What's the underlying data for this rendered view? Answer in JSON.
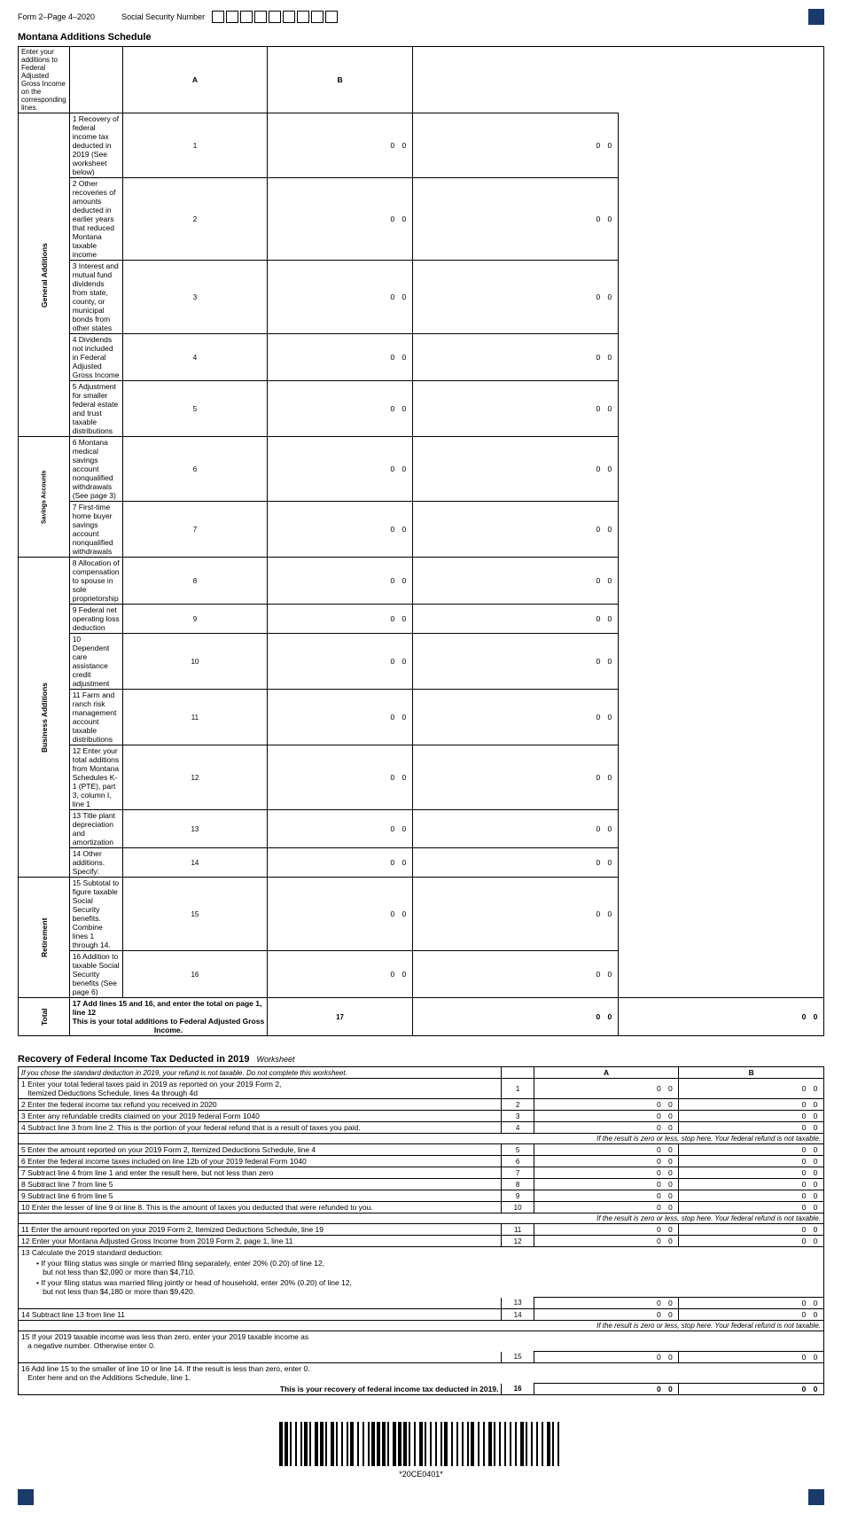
{
  "header": {
    "form_label": "Form 2–Page 4–2020",
    "ssn_label": "Social Security Number",
    "ssn_boxes": 9
  },
  "additions": {
    "title": "Montana Additions Schedule",
    "instruction": "Enter your additions to Federal Adjusted Gross Income on the corresponding lines.",
    "col_a": "A",
    "col_b": "B",
    "categories": {
      "general": "General Additions",
      "savings": "Savings Accounts",
      "business": "Business Additions",
      "retirement": "Retirement",
      "total": "Total"
    },
    "lines": [
      {
        "num": 1,
        "text": "1 Recovery of federal income tax deducted in 2019 (See worksheet below)",
        "cat": "general"
      },
      {
        "num": 2,
        "text": "2 Other recoveries of amounts deducted in earlier years that reduced Montana taxable income",
        "cat": "general"
      },
      {
        "num": 3,
        "text": "3 Interest and mutual fund dividends from state, county, or municipal bonds from other states",
        "cat": "general"
      },
      {
        "num": 4,
        "text": "4 Dividends not included in Federal Adjusted Gross Income",
        "cat": "general"
      },
      {
        "num": 5,
        "text": "5 Adjustment for smaller federal estate and trust taxable distributions",
        "cat": "general"
      },
      {
        "num": 6,
        "text": "6 Montana medical savings account nonqualified withdrawals (See page 3)",
        "cat": "savings"
      },
      {
        "num": 7,
        "text": "7 First-time home buyer savings account nonqualified withdrawals",
        "cat": "savings"
      },
      {
        "num": 8,
        "text": "8 Allocation of compensation to spouse in sole proprietorship",
        "cat": "business"
      },
      {
        "num": 9,
        "text": "9 Federal net operating loss deduction",
        "cat": "business"
      },
      {
        "num": 10,
        "text": "10 Dependent care assistance credit adjustment",
        "cat": "business"
      },
      {
        "num": 11,
        "text": "11 Farm and ranch risk management account taxable distributions",
        "cat": "business"
      },
      {
        "num": 12,
        "text": "12 Enter your total additions from Montana Schedules K-1 (PTE), part 3, column I, line 1",
        "cat": "business"
      },
      {
        "num": 13,
        "text": "13 Title plant depreciation and amortization",
        "cat": "business"
      },
      {
        "num": 14,
        "text": "14 Other additions. Specify:",
        "cat": "business"
      },
      {
        "num": 15,
        "text": "15 Subtotal to figure taxable Social Security benefits. Combine lines 1 through 14.",
        "cat": "retirement"
      },
      {
        "num": 16,
        "text": "16 Addition to taxable Social Security benefits (See page 6)",
        "cat": "retirement"
      },
      {
        "num": 17,
        "text": "17 Add lines 15 and 16, and enter the total on page 1, line 12",
        "cat": "total"
      }
    ],
    "total_label": "This is your total additions to Federal Adjusted Gross Income.",
    "total_line": "17"
  },
  "worksheet": {
    "title": "Recovery of Federal Income Tax Deducted in 2019",
    "label": "Worksheet",
    "col_a": "A",
    "col_b": "B",
    "instruction": "If you chose the standard deduction in 2019, your refund is not taxable. Do not complete this worksheet.",
    "lines": [
      {
        "num": 1,
        "text": "1 Enter your total federal taxes paid in 2019 as reported on your 2019 Form 2, Itemized Deductions Schedule, lines 4a through 4d"
      },
      {
        "num": 2,
        "text": "2 Enter the federal income tax refund you received in 2020"
      },
      {
        "num": 3,
        "text": "3 Enter any refundable credits claimed on your 2019 federal Form 1040"
      },
      {
        "num": 4,
        "text": "4 Subtract line 3 from line 2. This is the portion of your federal refund that is a result of taxes you paid."
      },
      {
        "num": "note1",
        "text": "If the result is zero or less, stop here. Your federal refund is not taxable.",
        "note": true
      },
      {
        "num": 5,
        "text": "5 Enter the amount reported on your 2019 Form 2, Itemized Deductions Schedule, line 4"
      },
      {
        "num": 6,
        "text": "6 Enter the federal income taxes included on line 12b of your 2019 federal Form 1040"
      },
      {
        "num": 7,
        "text": "7 Subtract line 4 from line 1 and enter the result here, but not less than zero"
      },
      {
        "num": 8,
        "text": "8 Subtract line 7 from line 5"
      },
      {
        "num": 9,
        "text": "9 Subtract line 6 from line 5"
      },
      {
        "num": 10,
        "text": "10 Enter the lesser of line 9 or line 8. This is the amount of taxes you deducted that were refunded to you."
      },
      {
        "num": "note2",
        "text": "If the result is zero or less, stop here. Your federal refund is not taxable.",
        "note": true
      },
      {
        "num": 11,
        "text": "11 Enter the amount reported on your 2019 Form 2, Itemized Deductions Schedule, line 19"
      },
      {
        "num": 12,
        "text": "12 Enter your Montana Adjusted Gross Income from 2019 Form 2, page 1, line 11"
      },
      {
        "num": 13,
        "text": "13 Calculate the 2019 standard deduction:"
      },
      {
        "num": "13a",
        "text": "• If your filing status was single or married filing separately, enter 20% (0.20) of line 12, but not less than $2,090 or more than $4,710.",
        "indent": true
      },
      {
        "num": "13b",
        "text": "• If your filing status was married filing jointly or head of household, enter 20% (0.20) of line 12, but not less than $4,180 or more than $9,420.",
        "indent": true
      },
      {
        "num": "13c",
        "text": "13",
        "shownum": true
      },
      {
        "num": 14,
        "text": "14 Subtract line 13 from line 11"
      },
      {
        "num": "note3",
        "text": "If the result is zero or less, stop here. Your federal refund is not taxable.",
        "note": true
      },
      {
        "num": 15,
        "text": "15 If your 2019 taxable income was less than zero, enter your 2019 taxable income as a negative number. Otherwise enter 0."
      },
      {
        "num": 16,
        "text": "16 Add line 15 to the smaller of line 10 or line 14. If the result is less than zero, enter 0. Enter here and on the Additions Schedule, line 1."
      },
      {
        "num": "16b",
        "text": "This is your recovery of federal income tax deducted in 2019.",
        "bold": true,
        "shownum": "16"
      }
    ]
  },
  "barcode": {
    "text": "*20CE0401*"
  }
}
